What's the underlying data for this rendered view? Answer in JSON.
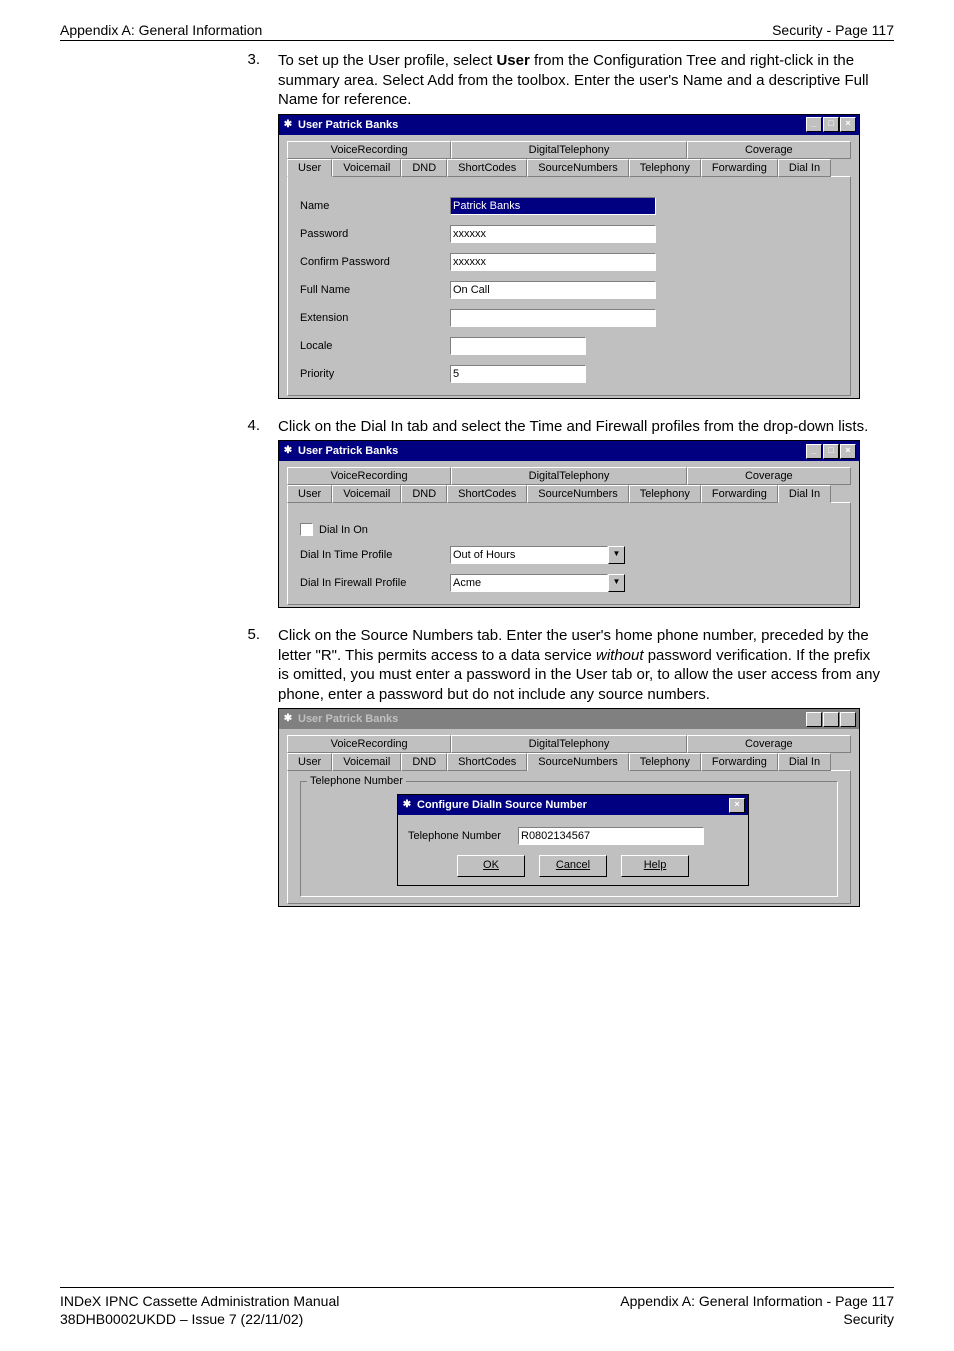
{
  "header": {
    "left": "Appendix A: General Information",
    "right": "Security - Page 117"
  },
  "steps": {
    "s3": {
      "num": "3.",
      "text_a": "To set up the User profile, select ",
      "bold": "User",
      "text_b": " from the Configuration Tree and right-click in the summary area. Select Add from the toolbox. Enter the user's Name and a descriptive Full Name for reference."
    },
    "s4": {
      "num": "4.",
      "text": "Click on the Dial In tab and select the Time and Firewall profiles from the drop-down lists."
    },
    "s5": {
      "num": "5.",
      "text_a": "Click on the Source Numbers tab. Enter the user's home phone number, preceded by the letter \"R\". This permits access to a data service ",
      "italic": "without",
      "text_b": " password verification. If the prefix is omitted, you must enter a password in the User tab or, to allow the user access from any phone, enter a password but do not include any source numbers."
    }
  },
  "win_common": {
    "title": "User Patrick Banks",
    "tabs_top": {
      "vr": "VoiceRecording",
      "dt": "DigitalTelephony",
      "cv": "Coverage"
    },
    "tabs_bot": {
      "user": "User",
      "vm": "Voicemail",
      "dnd": "DND",
      "sc": "ShortCodes",
      "sn": "SourceNumbers",
      "tel": "Telephony",
      "fwd": "Forwarding",
      "dialin": "Dial In"
    }
  },
  "win1": {
    "labels": {
      "name": "Name",
      "password": "Password",
      "confirm": "Confirm Password",
      "fullname": "Full Name",
      "extension": "Extension",
      "locale": "Locale",
      "priority": "Priority"
    },
    "values": {
      "name": "Patrick Banks",
      "password": "xxxxxx",
      "confirm": "xxxxxx",
      "fullname": "On Call",
      "extension": "",
      "locale": "",
      "priority": "5"
    }
  },
  "win2": {
    "labels": {
      "dialon": "Dial In On",
      "time": "Dial In Time Profile",
      "fw": "Dial In Firewall Profile"
    },
    "values": {
      "time": "Out of Hours",
      "fw": "Acme"
    }
  },
  "win3": {
    "group": "Telephone Number",
    "inner": {
      "title": "Configure DialIn Source Number",
      "label": "Telephone Number",
      "value": "R0802134567",
      "ok": "OK",
      "cancel": "Cancel",
      "help": "Help"
    }
  },
  "footer": {
    "l1": "INDeX IPNC Cassette Administration Manual",
    "l2": "38DHB0002UKDD – Issue 7 (22/11/02)",
    "r1": "Appendix A: General Information - Page 117",
    "r2": "Security"
  }
}
